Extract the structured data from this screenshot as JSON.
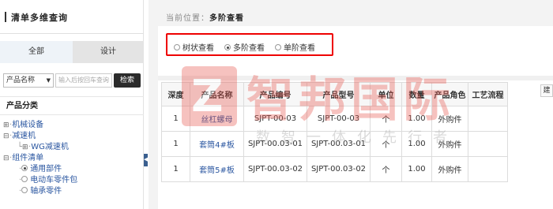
{
  "left": {
    "title": "清单多维查询",
    "tabs": [
      "全部",
      "设计"
    ],
    "search": {
      "select_value": "产品名称",
      "placeholder": "输入后按回车查询",
      "button": "检索"
    },
    "category_title": "产品分类",
    "tree": [
      {
        "label": "机械设备"
      },
      {
        "label": "减速机"
      },
      {
        "label": "WG减速机"
      },
      {
        "label": "组件清单"
      },
      {
        "label": "通用部件"
      },
      {
        "label": "电动车零件包"
      },
      {
        "label": "轴承零件"
      }
    ]
  },
  "main": {
    "breadcrumb_prefix": "当前位置：",
    "breadcrumb_current": "多阶查看",
    "view_options": [
      {
        "label": "树状查看",
        "selected": false
      },
      {
        "label": "多阶查看",
        "selected": true
      },
      {
        "label": "单阶查看",
        "selected": false
      }
    ],
    "corner_button": "建",
    "table": {
      "headers": [
        "深度",
        "产品名称",
        "产品编号",
        "产品型号",
        "单位",
        "数量",
        "产品角色",
        "工艺流程"
      ],
      "rows": [
        [
          "1",
          "丝杠螺母",
          "SJPT-00-03",
          "SJPT-00-03",
          "个",
          "1.00",
          "外购件",
          ""
        ],
        [
          "1",
          "套筒4#板",
          "SJPT-00.03-01",
          "SJPT-00.03-01",
          "个",
          "1.00",
          "外购件",
          ""
        ],
        [
          "1",
          "套筒5#板",
          "SJPT-00.03-02",
          "SJPT-00.03-02",
          "个",
          "1.00",
          "外购件",
          ""
        ]
      ]
    }
  },
  "watermark": {
    "logo_letter": "Z",
    "brand": "智邦国际",
    "slogan": "数智一体化先行者"
  },
  "colors": {
    "highlight_border": "#ee0000",
    "link": "#2a56a0",
    "search_button_bg": "#2b2b2b",
    "watermark_red": "#e8534a"
  }
}
